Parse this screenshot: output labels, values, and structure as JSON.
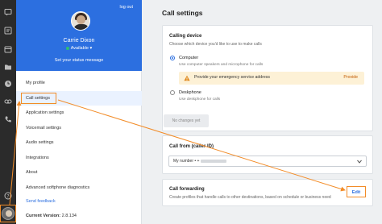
{
  "rail": {
    "icons": [
      "chat-icon",
      "voicemail-icon",
      "calendar-icon",
      "folder-icon",
      "history-icon",
      "recording-icon",
      "phone-icon",
      "help-icon"
    ]
  },
  "profile": {
    "logout": "log out",
    "name": "Carrie Dixon",
    "status": "Available",
    "status_color": "#2fbf71",
    "set_status": "Set your status message"
  },
  "menu": {
    "items": [
      {
        "label": "My profile"
      },
      {
        "label": "Call settings",
        "active": true
      },
      {
        "label": "Application settings"
      },
      {
        "label": "Voicemail settings"
      },
      {
        "label": "Audio settings"
      },
      {
        "label": "Integrations"
      },
      {
        "label": "About"
      },
      {
        "label": "Advanced softphone diagnostics"
      }
    ],
    "send_feedback": "Send feedback",
    "version_label": "Current Version:",
    "version_value": "2.8.134"
  },
  "main": {
    "title": "Call settings",
    "calling_device": {
      "title": "Calling device",
      "subtitle": "Choose which device you'd like to use to make calls",
      "options": [
        {
          "label": "Computer",
          "sub": "Use computer speakers and microphone for calls",
          "selected": true
        },
        {
          "label": "Deskphone",
          "sub": "Use deskphone for calls",
          "selected": false
        }
      ],
      "warning_text": "Provide your emergency service address",
      "warning_link": "Provide",
      "button": "No changes yet"
    },
    "caller_id": {
      "title": "Call from (caller ID)",
      "value": "My number • +"
    },
    "forwarding": {
      "title": "Call forwarding",
      "subtitle": "Create profiles that handle calls to other destinations, based on schedule or business need",
      "edit": "Edit"
    }
  },
  "colors": {
    "brand": "#2c6fe0",
    "highlight": "#f28c28",
    "warning_bg": "#fdf1d6"
  }
}
